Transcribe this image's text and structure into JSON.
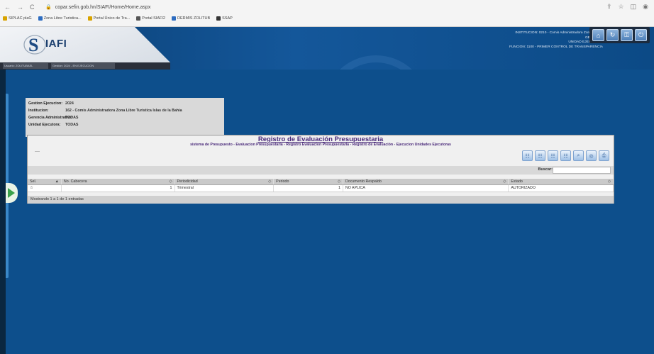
{
  "browser": {
    "url": "copar.sefin.gob.hn/SIAFI/Home/Home.aspx",
    "bookmarks": [
      {
        "label": "SIPLAC plaG",
        "color": "#d8a300"
      },
      {
        "label": "Zona Libre Turistica...",
        "color": "#2d6cc0"
      },
      {
        "label": "Portal Único de Tra...",
        "color": "#d8a300"
      },
      {
        "label": "Portal SIAFI2",
        "color": "#555555"
      },
      {
        "label": "DERMIS ZOLITUB",
        "color": "#2d6cc0"
      },
      {
        "label": "SSAP",
        "color": "#333333"
      }
    ]
  },
  "app": {
    "logo_text": "IAFI",
    "user_bar": {
      "user": "Usuario: ZOLITUBAEL",
      "gestion": "Gestión: 2024 - EN EJECUCION"
    },
    "institution_info": {
      "line1": "INSTITUCION: 0210 - Comis Administradora Zona Libre T",
      "line2": "GERENCIA",
      "line3": "UNIDAD EJECUTORA",
      "line4": "FUNCION: 1100 - PRIMER CONTROL DE TRANSPARENCIA"
    },
    "header_icons": [
      "home-icon",
      "refresh-icon",
      "key-icon",
      "power-icon"
    ]
  },
  "info_box": {
    "rows": [
      {
        "label": "Gestion Ejecucion:",
        "value": "2024"
      },
      {
        "label": "Institucion:",
        "value": "162 - Comis Administradora Zona Libre Turistica Islas de la Bahia"
      },
      {
        "label": "Gerencia Administrativa:",
        "value": "TODAS"
      },
      {
        "label": "Unidad Ejecutora:",
        "value": "TODAS"
      }
    ]
  },
  "panel": {
    "title": "Registro de Evaluación Presupuestaria",
    "subtitle": "sistema de Presupuesto - Evaluacion Presupuestaria - Registro Evaluacion Presupuestaria - Registro de Evaluación - Ejecucion Unidades Ejecutoras",
    "toolbar_icons": [
      "add-record-icon",
      "edit-record-icon",
      "view-record-icon",
      "list-record-icon",
      "search-icon",
      "zoom-icon",
      "print-icon"
    ],
    "search_label": "Buscar:",
    "search_value": ""
  },
  "grid": {
    "columns": [
      "Sel.",
      "No. Cabecera",
      "Periodicidad",
      "Periodo",
      "Documento Respaldo",
      "Estado"
    ],
    "rows": [
      {
        "sel": "☆",
        "no_cabecera": "1",
        "periodicidad": "Trimestral",
        "periodo": "1",
        "documento": "NO APLICA",
        "estado": "AUTORIZADO"
      }
    ],
    "footer": "Mostrando 1 a 1 de 1 entradas"
  }
}
